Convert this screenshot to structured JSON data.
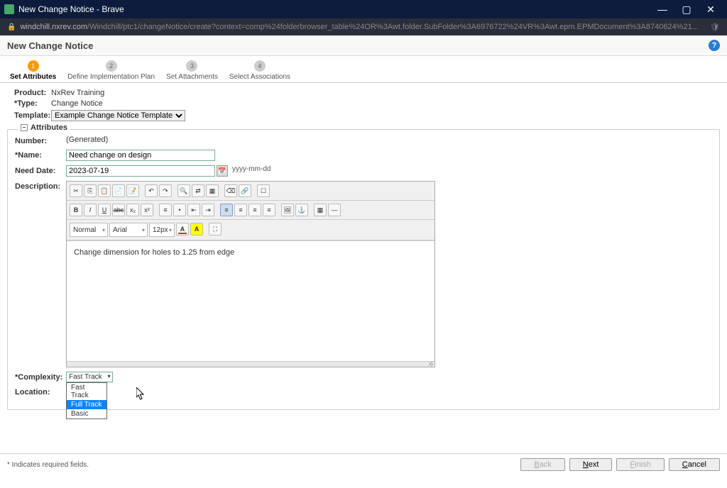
{
  "window": {
    "title": "New Change Notice - Brave",
    "url_host": "windchill.nxrev.com",
    "url_path": "/Windchill/ptc1/changeNotice/create?context=comp%24folderbrowser_table%24OR%3Awt.folder.SubFolder%3A6976722%24VR%3Awt.epm.EPMDocument%3A8740624%21..."
  },
  "page_title": "New Change Notice",
  "wizard": [
    {
      "num": "1",
      "label": "Set Attributes"
    },
    {
      "num": "2",
      "label": "Define Implementation Plan"
    },
    {
      "num": "3",
      "label": "Set Attachments"
    },
    {
      "num": "4",
      "label": "Select Associations"
    }
  ],
  "info": {
    "product_label": "Product:",
    "product_value": "NxRev Training",
    "type_label": "Type:",
    "type_value": "Change Notice",
    "template_label": "Template:",
    "template_value": "Example Change Notice Template"
  },
  "attributes": {
    "legend": "Attributes",
    "number_label": "Number:",
    "number_value": "(Generated)",
    "name_label": "Name:",
    "name_value": "Need change on design",
    "need_date_label": "Need Date:",
    "need_date_value": "2023-07-19",
    "need_date_hint": "yyyy-mm-dd",
    "description_label": "Description:",
    "description_value": "Change dimension for holes to 1.25 from edge",
    "rte": {
      "format": "Normal",
      "font": "Arial",
      "size": "12px"
    },
    "complexity_label": "Complexity:",
    "complexity_value": "Fast Track",
    "complexity_options": [
      "Fast Track",
      "Full Track",
      "Basic"
    ],
    "location_label": "Location:"
  },
  "footer": {
    "required_note": "* Indicates required fields.",
    "back": "Back",
    "next": "Next",
    "finish": "Finish",
    "cancel": "Cancel"
  }
}
